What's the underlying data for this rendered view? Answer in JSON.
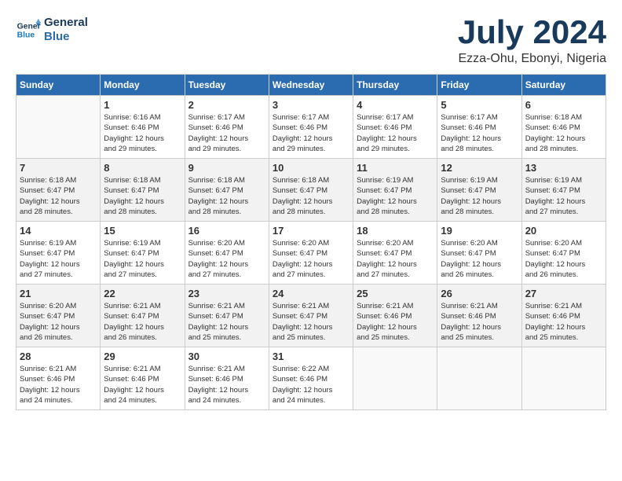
{
  "header": {
    "logo_line1": "General",
    "logo_line2": "Blue",
    "month": "July 2024",
    "location": "Ezza-Ohu, Ebonyi, Nigeria"
  },
  "weekdays": [
    "Sunday",
    "Monday",
    "Tuesday",
    "Wednesday",
    "Thursday",
    "Friday",
    "Saturday"
  ],
  "rows": [
    {
      "shaded": false,
      "cells": [
        {
          "empty": true
        },
        {
          "day": "1",
          "sunrise": "6:16 AM",
          "sunset": "6:46 PM",
          "daylight": "12 hours and 29 minutes."
        },
        {
          "day": "2",
          "sunrise": "6:17 AM",
          "sunset": "6:46 PM",
          "daylight": "12 hours and 29 minutes."
        },
        {
          "day": "3",
          "sunrise": "6:17 AM",
          "sunset": "6:46 PM",
          "daylight": "12 hours and 29 minutes."
        },
        {
          "day": "4",
          "sunrise": "6:17 AM",
          "sunset": "6:46 PM",
          "daylight": "12 hours and 29 minutes."
        },
        {
          "day": "5",
          "sunrise": "6:17 AM",
          "sunset": "6:46 PM",
          "daylight": "12 hours and 28 minutes."
        },
        {
          "day": "6",
          "sunrise": "6:18 AM",
          "sunset": "6:46 PM",
          "daylight": "12 hours and 28 minutes."
        }
      ]
    },
    {
      "shaded": true,
      "cells": [
        {
          "day": "7",
          "sunrise": "6:18 AM",
          "sunset": "6:47 PM",
          "daylight": "12 hours and 28 minutes."
        },
        {
          "day": "8",
          "sunrise": "6:18 AM",
          "sunset": "6:47 PM",
          "daylight": "12 hours and 28 minutes."
        },
        {
          "day": "9",
          "sunrise": "6:18 AM",
          "sunset": "6:47 PM",
          "daylight": "12 hours and 28 minutes."
        },
        {
          "day": "10",
          "sunrise": "6:18 AM",
          "sunset": "6:47 PM",
          "daylight": "12 hours and 28 minutes."
        },
        {
          "day": "11",
          "sunrise": "6:19 AM",
          "sunset": "6:47 PM",
          "daylight": "12 hours and 28 minutes."
        },
        {
          "day": "12",
          "sunrise": "6:19 AM",
          "sunset": "6:47 PM",
          "daylight": "12 hours and 28 minutes."
        },
        {
          "day": "13",
          "sunrise": "6:19 AM",
          "sunset": "6:47 PM",
          "daylight": "12 hours and 27 minutes."
        }
      ]
    },
    {
      "shaded": false,
      "cells": [
        {
          "day": "14",
          "sunrise": "6:19 AM",
          "sunset": "6:47 PM",
          "daylight": "12 hours and 27 minutes."
        },
        {
          "day": "15",
          "sunrise": "6:19 AM",
          "sunset": "6:47 PM",
          "daylight": "12 hours and 27 minutes."
        },
        {
          "day": "16",
          "sunrise": "6:20 AM",
          "sunset": "6:47 PM",
          "daylight": "12 hours and 27 minutes."
        },
        {
          "day": "17",
          "sunrise": "6:20 AM",
          "sunset": "6:47 PM",
          "daylight": "12 hours and 27 minutes."
        },
        {
          "day": "18",
          "sunrise": "6:20 AM",
          "sunset": "6:47 PM",
          "daylight": "12 hours and 27 minutes."
        },
        {
          "day": "19",
          "sunrise": "6:20 AM",
          "sunset": "6:47 PM",
          "daylight": "12 hours and 26 minutes."
        },
        {
          "day": "20",
          "sunrise": "6:20 AM",
          "sunset": "6:47 PM",
          "daylight": "12 hours and 26 minutes."
        }
      ]
    },
    {
      "shaded": true,
      "cells": [
        {
          "day": "21",
          "sunrise": "6:20 AM",
          "sunset": "6:47 PM",
          "daylight": "12 hours and 26 minutes."
        },
        {
          "day": "22",
          "sunrise": "6:21 AM",
          "sunset": "6:47 PM",
          "daylight": "12 hours and 26 minutes."
        },
        {
          "day": "23",
          "sunrise": "6:21 AM",
          "sunset": "6:47 PM",
          "daylight": "12 hours and 25 minutes."
        },
        {
          "day": "24",
          "sunrise": "6:21 AM",
          "sunset": "6:47 PM",
          "daylight": "12 hours and 25 minutes."
        },
        {
          "day": "25",
          "sunrise": "6:21 AM",
          "sunset": "6:46 PM",
          "daylight": "12 hours and 25 minutes."
        },
        {
          "day": "26",
          "sunrise": "6:21 AM",
          "sunset": "6:46 PM",
          "daylight": "12 hours and 25 minutes."
        },
        {
          "day": "27",
          "sunrise": "6:21 AM",
          "sunset": "6:46 PM",
          "daylight": "12 hours and 25 minutes."
        }
      ]
    },
    {
      "shaded": false,
      "cells": [
        {
          "day": "28",
          "sunrise": "6:21 AM",
          "sunset": "6:46 PM",
          "daylight": "12 hours and 24 minutes."
        },
        {
          "day": "29",
          "sunrise": "6:21 AM",
          "sunset": "6:46 PM",
          "daylight": "12 hours and 24 minutes."
        },
        {
          "day": "30",
          "sunrise": "6:21 AM",
          "sunset": "6:46 PM",
          "daylight": "12 hours and 24 minutes."
        },
        {
          "day": "31",
          "sunrise": "6:22 AM",
          "sunset": "6:46 PM",
          "daylight": "12 hours and 24 minutes."
        },
        {
          "empty": true
        },
        {
          "empty": true
        },
        {
          "empty": true
        }
      ]
    }
  ]
}
